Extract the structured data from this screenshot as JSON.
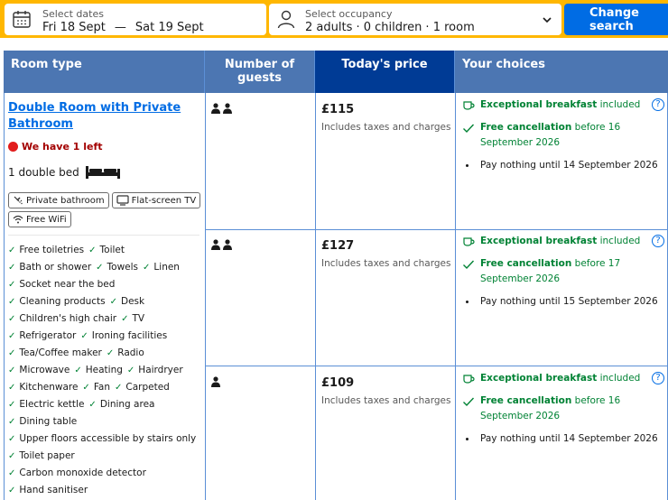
{
  "search": {
    "dates_label": "Select dates",
    "check_in": "Fri 18 Sept",
    "separator": "—",
    "check_out": "Sat 19 Sept",
    "occupancy_label": "Select occupancy",
    "occupancy_value": "2 adults · 0 children · 1 room",
    "button": "Change search",
    "accent_color": "#ffb700",
    "button_color": "#006ce4"
  },
  "table": {
    "headers": {
      "room_type": "Room type",
      "guests": "Number of guests",
      "price": "Today's price",
      "choices": "Your choices"
    },
    "header_color": "#4c76b2",
    "price_header_color": "#003b95"
  },
  "room": {
    "name": "Double Room with Private Bathroom",
    "scarcity": "We have 1 left",
    "bed": "1 double bed",
    "badges": [
      "Private bathroom",
      "Flat-screen TV",
      "Free WiFi"
    ],
    "amenities": [
      "Free toiletries",
      "Toilet",
      "Bath or shower",
      "Towels",
      "Linen",
      "Socket near the bed",
      "Cleaning products",
      "Desk",
      "Children's high chair",
      "TV",
      "Refrigerator",
      "Ironing facilities",
      "Tea/Coffee maker",
      "Radio",
      "Microwave",
      "Heating",
      "Hairdryer",
      "Kitchenware",
      "Fan",
      "Carpeted",
      "Electric kettle",
      "Dining area",
      "Dining table",
      "Upper floors accessible by stairs only",
      "Toilet paper",
      "Carbon monoxide detector",
      "Hand sanitiser"
    ]
  },
  "options": [
    {
      "guests": 2,
      "price": "£115",
      "price_note": "Includes taxes and charges",
      "breakfast_bold": "Exceptional breakfast",
      "breakfast_rest": "included",
      "cancel_bold": "Free cancellation",
      "cancel_rest": "before 16 September 2026",
      "pay": "Pay nothing until 14 September 2026"
    },
    {
      "guests": 2,
      "price": "£127",
      "price_note": "Includes taxes and charges",
      "breakfast_bold": "Exceptional breakfast",
      "breakfast_rest": "included",
      "cancel_bold": "Free cancellation",
      "cancel_rest": "before 17 September 2026",
      "pay": "Pay nothing until 15 September 2026"
    },
    {
      "guests": 1,
      "price": "£109",
      "price_note": "Includes taxes and charges",
      "breakfast_bold": "Exceptional breakfast",
      "breakfast_rest": "included",
      "cancel_bold": "Free cancellation",
      "cancel_rest": "before 16 September 2026",
      "pay": "Pay nothing until 14 September 2026"
    }
  ],
  "help_glyph": "?"
}
